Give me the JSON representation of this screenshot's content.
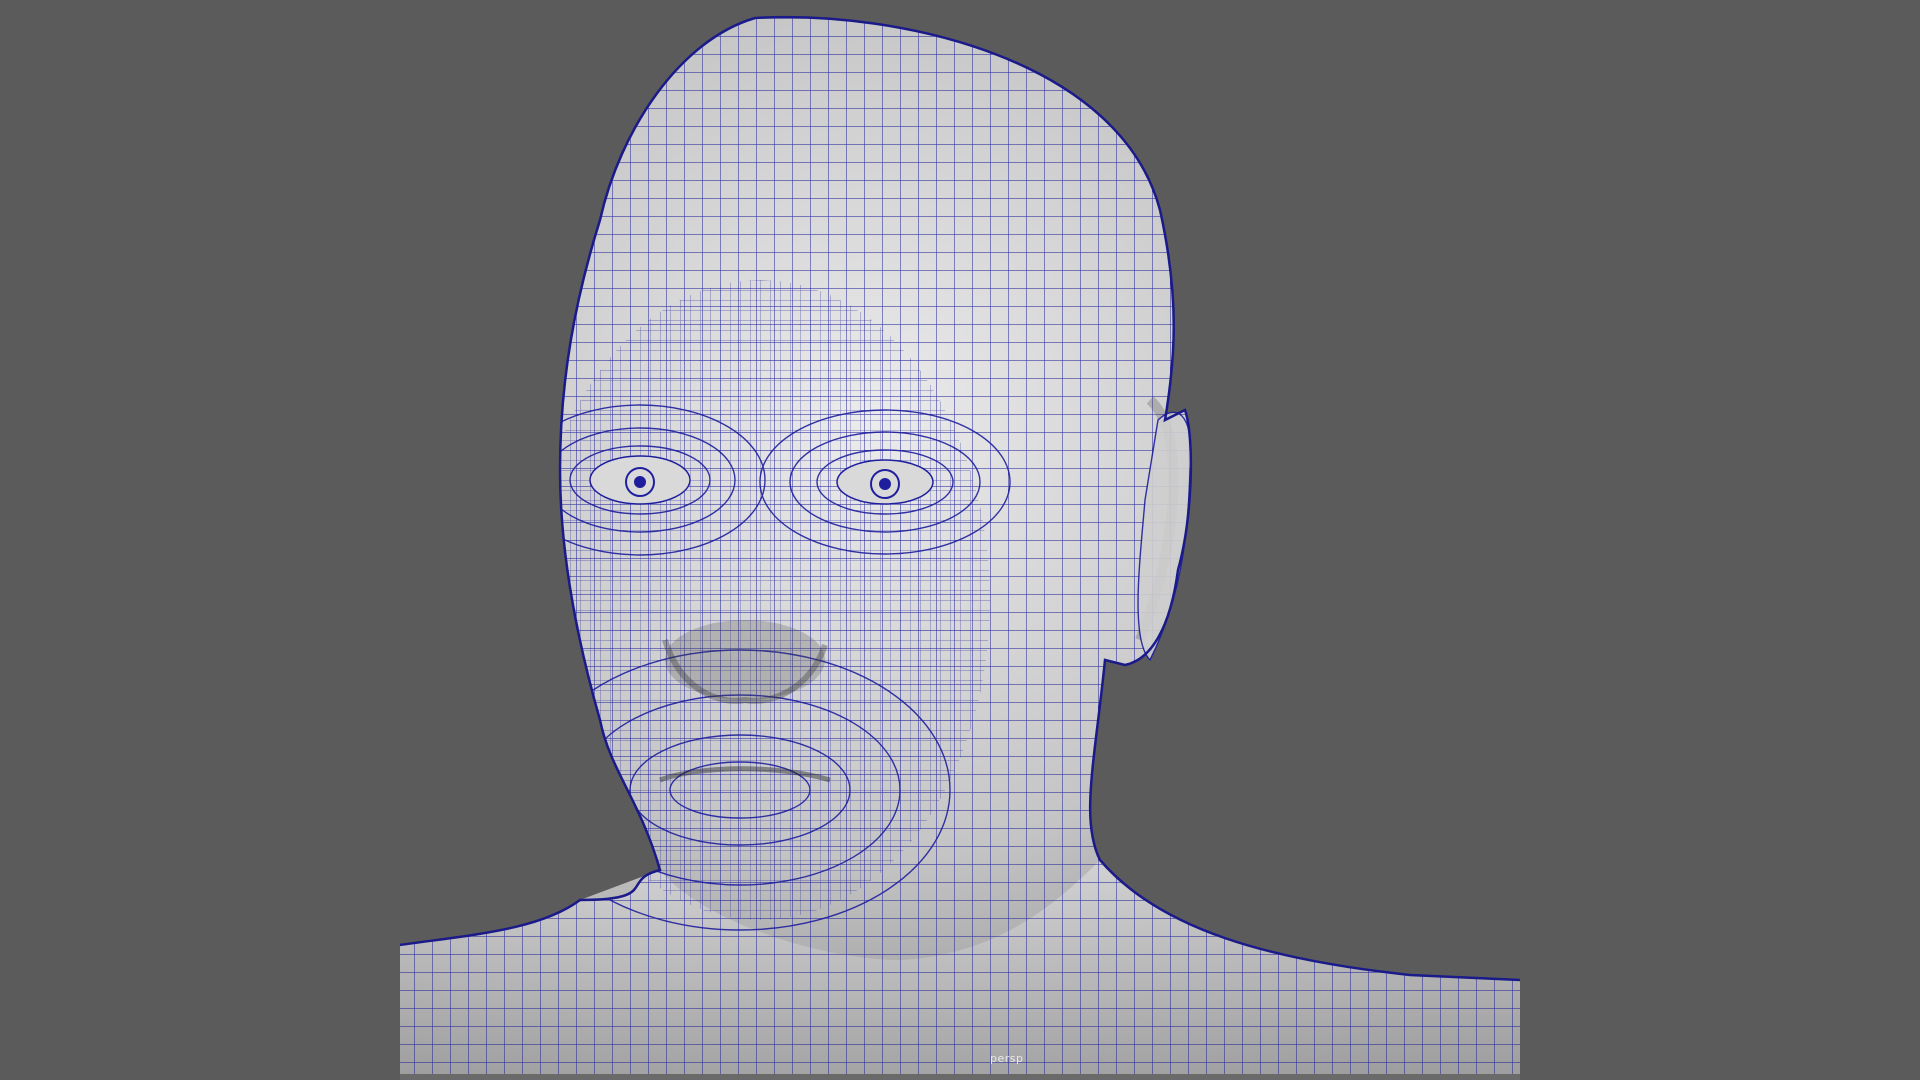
{
  "viewport": {
    "camera_label": "persp",
    "background_color": "#5b5b5b",
    "wireframe_color": "#1f1f9e",
    "mesh_shade_light": "#e6e6e6",
    "mesh_shade_dark": "#6e6e6e"
  },
  "model": {
    "icon": "polygon-mesh-icon"
  }
}
